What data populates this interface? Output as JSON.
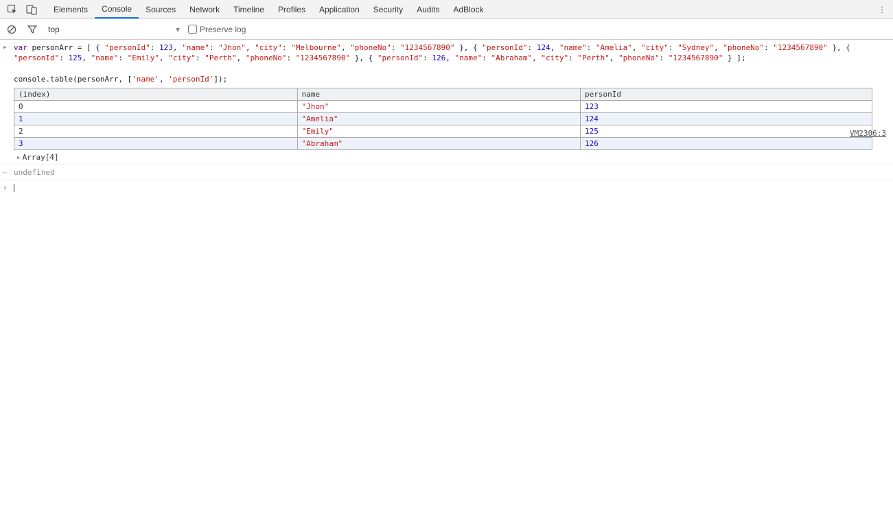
{
  "tabs": [
    "Elements",
    "Console",
    "Sources",
    "Network",
    "Timeline",
    "Profiles",
    "Application",
    "Security",
    "Audits",
    "AdBlock"
  ],
  "activeTab": "Console",
  "toolbar": {
    "context": "top",
    "preserve": "Preserve log"
  },
  "code": {
    "kw": "var",
    "decl": " personArr = [ { ",
    "items": [
      {
        "k": "\"personId\"",
        "c": ": ",
        "v": "123",
        "t": "num"
      },
      {
        "k": "\"name\"",
        "c": ": ",
        "v": "\"Jhon\"",
        "t": "str"
      },
      {
        "k": "\"city\"",
        "c": ": ",
        "v": "\"Melbourne\"",
        "t": "str"
      },
      {
        "k": "\"phoneNo\"",
        "c": ": ",
        "v": "\"1234567890\"",
        "t": "str"
      }
    ],
    "sep1": " }, { ",
    "items2": [
      {
        "k": "\"personId\"",
        "c": ": ",
        "v": "124",
        "t": "num"
      },
      {
        "k": "\"name\"",
        "c": ": ",
        "v": "\"Amelia\"",
        "t": "str"
      },
      {
        "k": "\"city\"",
        "c": ": ",
        "v": "\"Sydney\"",
        "t": "str"
      },
      {
        "k": "\"phoneNo\"",
        "c": ": ",
        "v": "\"1234567890\"",
        "t": "str"
      }
    ],
    "sep2": " }, { ",
    "items3": [
      {
        "k": "\"personId\"",
        "c": ": ",
        "v": "125",
        "t": "num"
      },
      {
        "k": "\"name\"",
        "c": ": ",
        "v": "\"Emily\"",
        "t": "str"
      },
      {
        "k": "\"city\"",
        "c": ": ",
        "v": "\"Perth\"",
        "t": "str"
      },
      {
        "k": "\"phoneNo\"",
        "c": ": ",
        "v": "\"1234567890\"",
        "t": "str"
      }
    ],
    "sep3": " }, { ",
    "items4": [
      {
        "k": "\"personId\"",
        "c": ": ",
        "v": "126",
        "t": "num"
      },
      {
        "k": "\"name\"",
        "c": ": ",
        "v": "\"Abraham\"",
        "t": "str"
      },
      {
        "k": "\"city\"",
        "c": ": ",
        "v": "\"Perth\"",
        "t": "str"
      },
      {
        "k": "\"phoneNo\"",
        "c": ": ",
        "v": "\"1234567890\"",
        "t": "str"
      }
    ],
    "end": " } ];",
    "call1": "console.table(personArr, [",
    "arg1": "'name'",
    "comma": ", ",
    "arg2": "'personId'",
    "call2": "]);"
  },
  "srcLink": "VM2306:3",
  "table": {
    "headers": [
      "(index)",
      "name",
      "personId"
    ],
    "rows": [
      {
        "idx": "0",
        "name": "\"Jhon\"",
        "pid": "123"
      },
      {
        "idx": "1",
        "name": "\"Amelia\"",
        "pid": "124"
      },
      {
        "idx": "2",
        "name": "\"Emily\"",
        "pid": "125"
      },
      {
        "idx": "3",
        "name": "\"Abraham\"",
        "pid": "126"
      }
    ]
  },
  "arrSummary": "Array[4]",
  "undef": "undefined"
}
